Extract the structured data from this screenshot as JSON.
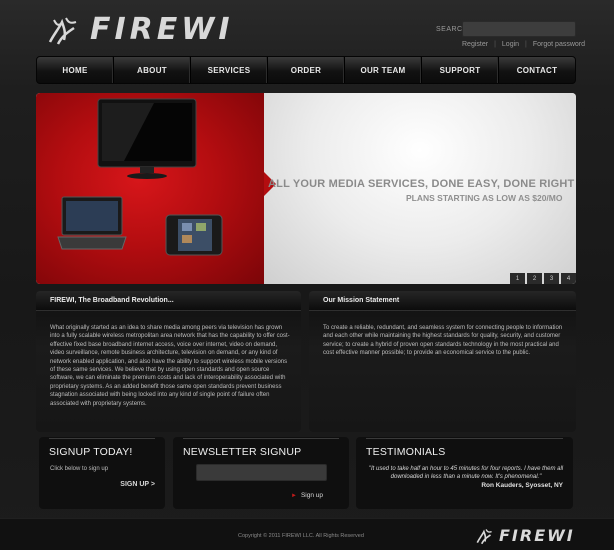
{
  "header": {
    "logo_text": "FIREWI",
    "search_label": "SEARCH",
    "search_value": "",
    "links": [
      "Register",
      "Login",
      "Forgot password"
    ]
  },
  "nav": {
    "items": [
      "HOME",
      "ABOUT",
      "SERVICES",
      "ORDER",
      "OUR TEAM",
      "SUPPORT",
      "CONTACT"
    ]
  },
  "banner": {
    "headline": "ALL YOUR MEDIA SERVICES, DONE EASY, DONE RIGHT",
    "subline": "PLANS STARTING AS LOW AS $20/MO",
    "pager": [
      "1",
      "2",
      "3",
      "4"
    ],
    "colors": {
      "red": "#b30d10",
      "light": "#ececec"
    }
  },
  "panel_left": {
    "title": "FIREWI, The Broadband Revolution...",
    "body": "What originally started as an idea to share media among peers via television has grown into a fully scalable wireless metropolitan area network that has the capability to offer cost-effective fixed base broadband internet access, voice over internet, video on demand, video surveillance, remote business architecture, television on demand, or any kind of network enabled application, and also have the ability to support wireless mobile versions of these same services.  We believe that by using open standards and open source software, we can eliminate the premium costs and lack of interoperability associated with proprietary systems.  As an added benefit those same open standards prevent business stagnation associated with being locked into any kind of single point of failure often associated with proprietary systems."
  },
  "panel_right": {
    "title": "Our Mission Statement",
    "body": "To create a reliable, redundant, and seamless system for connecting people to information and each other while maintaining the highest standards for quality, security, and customer service; to create a hybrid of proven open standards technology in the most practical and cost effective manner possible; to provide an economical service to the public."
  },
  "signup": {
    "title": "SIGNUP TODAY!",
    "text": "Click below to sign up",
    "link": "SIGN UP >"
  },
  "newsletter": {
    "title": "NEWSLETTER SIGNUP",
    "input_value": "",
    "button": "Sign up"
  },
  "testimonials": {
    "title": "TESTIMONIALS",
    "quote": "\"It used to take half an hour to 45 minutes for four reports. I have them all downloaded in less than a minute now. It's phenomenal.\"",
    "author": "Ron Kauders, Syosset, NY"
  },
  "footer": {
    "copyright": "Copyright © 2011 FIREWI LLC. All Rights Reserved",
    "logo_text": "FIREWI"
  }
}
